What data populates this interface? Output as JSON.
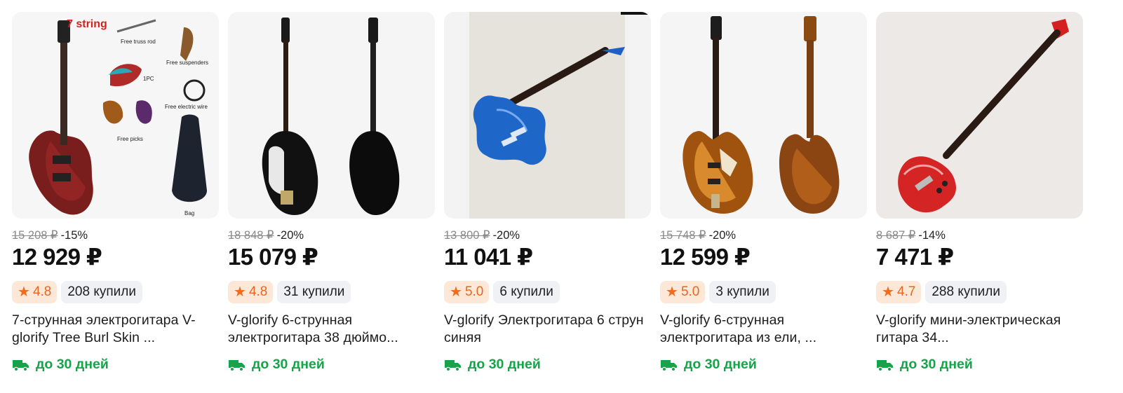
{
  "products": [
    {
      "old_price": "15 208 ₽",
      "discount": "-15%",
      "price": "12 929 ₽",
      "rating": "4.8",
      "bought": "208 купили",
      "title": "7-струнная электрогитара V-glorify Tree Burl Skin ...",
      "delivery": "до 30 дней",
      "image_texts": [
        "7 string",
        "Free truss rod",
        "Free suspenders",
        "1PC",
        "Free electric wire",
        "Free picks",
        "Bag"
      ]
    },
    {
      "old_price": "18 848 ₽",
      "discount": "-20%",
      "price": "15 079 ₽",
      "rating": "4.8",
      "bought": "31 купили",
      "title": "V-glorify 6-струнная электрогитара 38 дюймо...",
      "delivery": "до 30 дней"
    },
    {
      "old_price": "13 800 ₽",
      "discount": "-20%",
      "price": "11 041 ₽",
      "rating": "5.0",
      "bought": "6 купили",
      "title": "V-glorify Электрогитара 6 струн синяя",
      "delivery": "до 30 дней"
    },
    {
      "old_price": "15 748 ₽",
      "discount": "-20%",
      "price": "12 599 ₽",
      "rating": "5.0",
      "bought": "3 купили",
      "title": "V-glorify 6-струнная электрогитара из ели, ...",
      "delivery": "до 30 дней"
    },
    {
      "old_price": "8 687 ₽",
      "discount": "-14%",
      "price": "7 471 ₽",
      "rating": "4.7",
      "bought": "288 купили",
      "title": "V-glorify мини-электрическая гитара 34...",
      "delivery": "до 30 дней"
    }
  ],
  "icons": {
    "rating": "star-icon",
    "delivery": "truck-icon"
  },
  "colors": {
    "delivery": "#17a34a",
    "rating": "#f26a1b",
    "rating_bg": "#fde8d8",
    "badge_bg": "#f0f1f4"
  }
}
